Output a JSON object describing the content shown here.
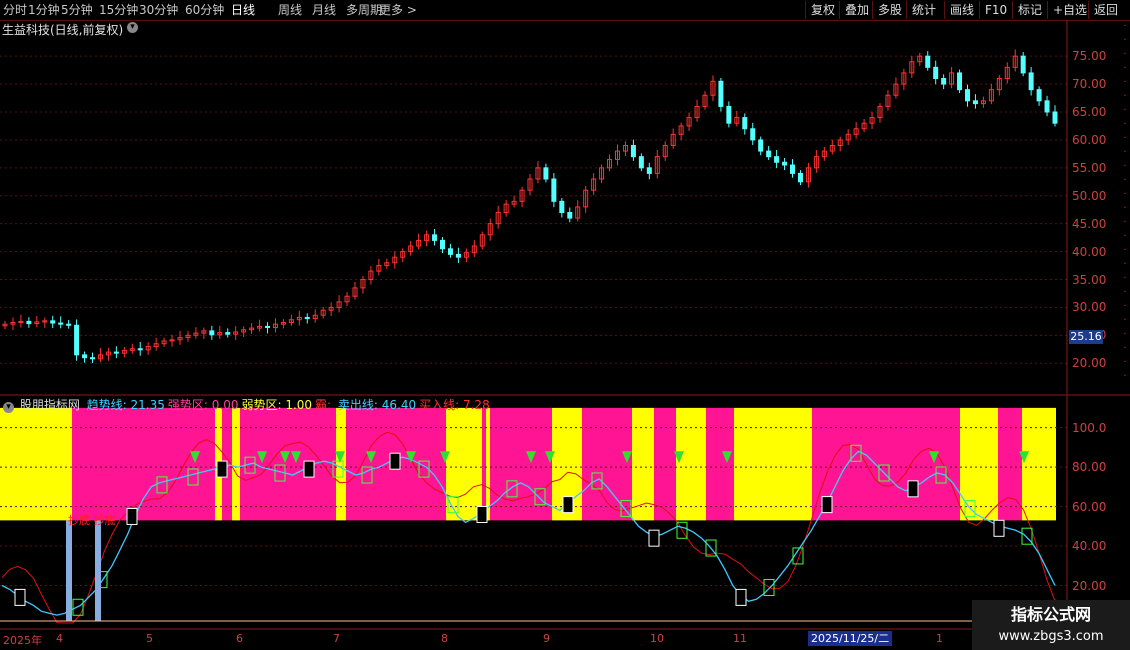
{
  "toolbar": {
    "periods": [
      "分时",
      "1分钟",
      "5分钟",
      "15分钟",
      "30分钟",
      "60分钟",
      "日线",
      "周线",
      "月线",
      "多周期",
      "更多 >"
    ],
    "active_period": "日线",
    "right_buttons": [
      "复权",
      "叠加",
      "多股",
      "统计",
      "画线",
      "F10",
      "标记",
      "+自选",
      "返回"
    ]
  },
  "stock": {
    "title": "生益科技(日线,前复权)"
  },
  "price_axis": {
    "labels": [
      "75.00",
      "70.00",
      "65.00",
      "60.00",
      "55.00",
      "50.00",
      "45.00",
      "40.00",
      "35.00",
      "30.00",
      "25.00",
      "20.00"
    ],
    "last_price": "25.16"
  },
  "indicator": {
    "name": "股朋指标网",
    "params": [
      {
        "label": "趋势线:",
        "value": "21.35",
        "color": "#40d0ff"
      },
      {
        "label": "强势区:",
        "value": "0.00",
        "color": "#ff40a0"
      },
      {
        "label": "弱势区:",
        "value": "1.00",
        "color": "#ffff40"
      },
      {
        "label": "霸:",
        "value": "",
        "color": "#ff3030"
      },
      {
        "label": "卖出线:",
        "value": "46.40",
        "color": "#40d0ff"
      },
      {
        "label": "买入线:",
        "value": "7.28",
        "color": "#ff3030"
      }
    ],
    "axis_labels": [
      "100.0",
      "80.00",
      "60.00",
      "40.00",
      "20.00"
    ],
    "annotation": "抄底 抄底"
  },
  "dates": {
    "labels": [
      "2025年",
      "4",
      "5",
      "6",
      "7",
      "8",
      "9",
      "10",
      "11",
      "1"
    ],
    "highlight": "2025/11/25/二"
  },
  "watermark": {
    "line1": "指标公式网",
    "line2": "www.zbgs3.com"
  },
  "chart_data": {
    "type": "candlestick",
    "title": "生益科技(日线,前复权)",
    "ylim": [
      17,
      77
    ],
    "close_series": [
      27,
      27.3,
      27.5,
      27.1,
      27.4,
      27.6,
      27.2,
      27,
      26.8,
      21.5,
      21,
      20.8,
      21.5,
      22,
      21.8,
      22.3,
      22.6,
      22.4,
      23,
      23.5,
      24,
      24.2,
      24.6,
      25,
      25.4,
      25.8,
      25.1,
      25.5,
      25.2,
      25.6,
      26,
      26.3,
      26.6,
      26.4,
      27,
      27.3,
      27.8,
      28.2,
      28,
      28.6,
      29.5,
      30,
      31,
      32,
      33.5,
      35,
      36.5,
      37.5,
      38,
      39,
      40,
      41,
      42,
      43,
      42,
      40.5,
      39.5,
      39,
      39.8,
      41,
      43,
      45,
      47,
      48.5,
      49,
      51,
      53,
      55,
      53,
      49,
      47,
      46,
      48,
      51,
      53,
      55,
      56.5,
      58,
      59,
      57,
      55,
      54,
      57,
      59,
      61,
      62.5,
      64,
      66,
      68,
      70.5,
      66,
      63,
      64,
      62,
      60,
      58,
      57,
      56,
      55.5,
      54,
      52.5,
      55,
      57,
      58,
      59,
      60,
      61,
      62,
      63,
      64,
      66,
      68,
      70,
      72,
      74,
      75,
      73,
      71,
      70,
      72,
      69,
      67,
      66.5,
      67,
      69,
      71,
      73,
      75,
      72,
      69,
      67,
      65,
      63
    ]
  },
  "indicator_data": {
    "ylim": [
      0,
      115
    ],
    "axis_ticks": [
      20,
      40,
      60,
      80,
      100
    ],
    "band_top": 110,
    "band_bottom": 53,
    "zones": [
      {
        "color": "#ffff00",
        "from": 0,
        "to": 72
      },
      {
        "color": "#ff1493",
        "from": 72,
        "to": 215
      },
      {
        "color": "#ffff00",
        "from": 215,
        "to": 222
      },
      {
        "color": "#ff1493",
        "from": 222,
        "to": 232
      },
      {
        "color": "#ffff00",
        "from": 232,
        "to": 240
      },
      {
        "color": "#ff1493",
        "from": 240,
        "to": 336
      },
      {
        "color": "#ffff00",
        "from": 336,
        "to": 346
      },
      {
        "color": "#ff1493",
        "from": 346,
        "to": 446
      },
      {
        "color": "#ffff00",
        "from": 446,
        "to": 482
      },
      {
        "color": "#ff1493",
        "from": 482,
        "to": 486
      },
      {
        "color": "#ffff00",
        "from": 486,
        "to": 490
      },
      {
        "color": "#ff1493",
        "from": 490,
        "to": 552
      },
      {
        "color": "#ffff00",
        "from": 552,
        "to": 582
      },
      {
        "color": "#ff1493",
        "from": 582,
        "to": 632
      },
      {
        "color": "#ffff00",
        "from": 632,
        "to": 654
      },
      {
        "color": "#ff1493",
        "from": 654,
        "to": 676
      },
      {
        "color": "#ffff00",
        "from": 676,
        "to": 706
      },
      {
        "color": "#ff1493",
        "from": 706,
        "to": 734
      },
      {
        "color": "#ffff00",
        "from": 734,
        "to": 812
      },
      {
        "color": "#ff1493",
        "from": 812,
        "to": 960
      },
      {
        "color": "#ffff00",
        "from": 960,
        "to": 998
      },
      {
        "color": "#ff1493",
        "from": 998,
        "to": 1022
      },
      {
        "color": "#ffff00",
        "from": 1022,
        "to": 1056
      }
    ],
    "trend_series": [
      20,
      18,
      15,
      12,
      10,
      7,
      6,
      5,
      6,
      8,
      10,
      14,
      18,
      24,
      30,
      38,
      46,
      56,
      64,
      70,
      72,
      73,
      74,
      75,
      76,
      77,
      78,
      79,
      80,
      81,
      80,
      81,
      82,
      80,
      79,
      78,
      77,
      76,
      78,
      80,
      82,
      83,
      82,
      80,
      78,
      76,
      77,
      79,
      80,
      82,
      84,
      85,
      84,
      82,
      80,
      76,
      70,
      62,
      55,
      52,
      54,
      57,
      60,
      63,
      67,
      70,
      72,
      70,
      66,
      62,
      60,
      58,
      62,
      65,
      68,
      72,
      74,
      70,
      65,
      60,
      55,
      50,
      47,
      45,
      46,
      48,
      50,
      49,
      47,
      44,
      40,
      35,
      28,
      20,
      15,
      12,
      13,
      16,
      20,
      25,
      30,
      36,
      42,
      48,
      55,
      62,
      70,
      78,
      84,
      88,
      86,
      82,
      78,
      74,
      70,
      68,
      70,
      72,
      75,
      77,
      76,
      72,
      66,
      60,
      56,
      54,
      52,
      50,
      49,
      48,
      46,
      42,
      36,
      28,
      20
    ]
  }
}
